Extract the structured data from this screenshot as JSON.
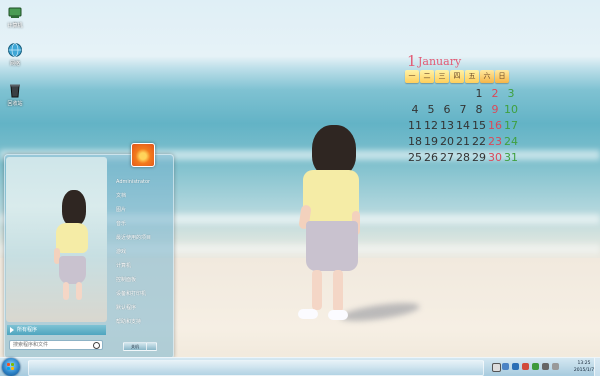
{
  "desktop": {
    "icons": [
      {
        "label": "计算机",
        "icon": "computer-icon"
      },
      {
        "label": "网络",
        "icon": "network-globe-icon"
      },
      {
        "label": "回收站",
        "icon": "recycle-bin-icon"
      }
    ]
  },
  "calendar": {
    "month_number": "1",
    "month_name": "January",
    "weekdays": [
      "一",
      "二",
      "三",
      "四",
      "五",
      "六",
      "日"
    ],
    "weeks": [
      [
        "",
        "",
        "",
        "",
        "1",
        "2",
        "3"
      ],
      [
        "4",
        "5",
        "6",
        "7",
        "8",
        "9",
        "10"
      ],
      [
        "11",
        "12",
        "13",
        "14",
        "15",
        "16",
        "17"
      ],
      [
        "18",
        "19",
        "20",
        "21",
        "22",
        "23",
        "24"
      ],
      [
        "25",
        "26",
        "27",
        "28",
        "29",
        "30",
        "31"
      ]
    ],
    "colors": {
      "title": "#e25b75",
      "saturday": "#d94a5a",
      "sunday": "#3fa03f",
      "weekday": "#333333"
    }
  },
  "start_menu": {
    "user_picture": "flower-user-picture",
    "right_items": [
      "Administrator",
      "文档",
      "图片",
      "音乐",
      "最近使用的项目",
      "游戏",
      "计算机",
      "控制面板",
      "设备和打印机",
      "默认程序",
      "帮助和支持"
    ],
    "all_programs": "所有程序",
    "search_placeholder": "搜索程序和文件",
    "shutdown_label": "关机"
  },
  "taskbar": {
    "clock_time": "13:25",
    "clock_date": "2015/1/7",
    "tray_icons": [
      "network-icon",
      "volume-icon",
      "flag-icon",
      "antivirus-icon"
    ]
  },
  "colors": {
    "accent": "#4fa5bf",
    "start_orb": "#2d84c8"
  }
}
